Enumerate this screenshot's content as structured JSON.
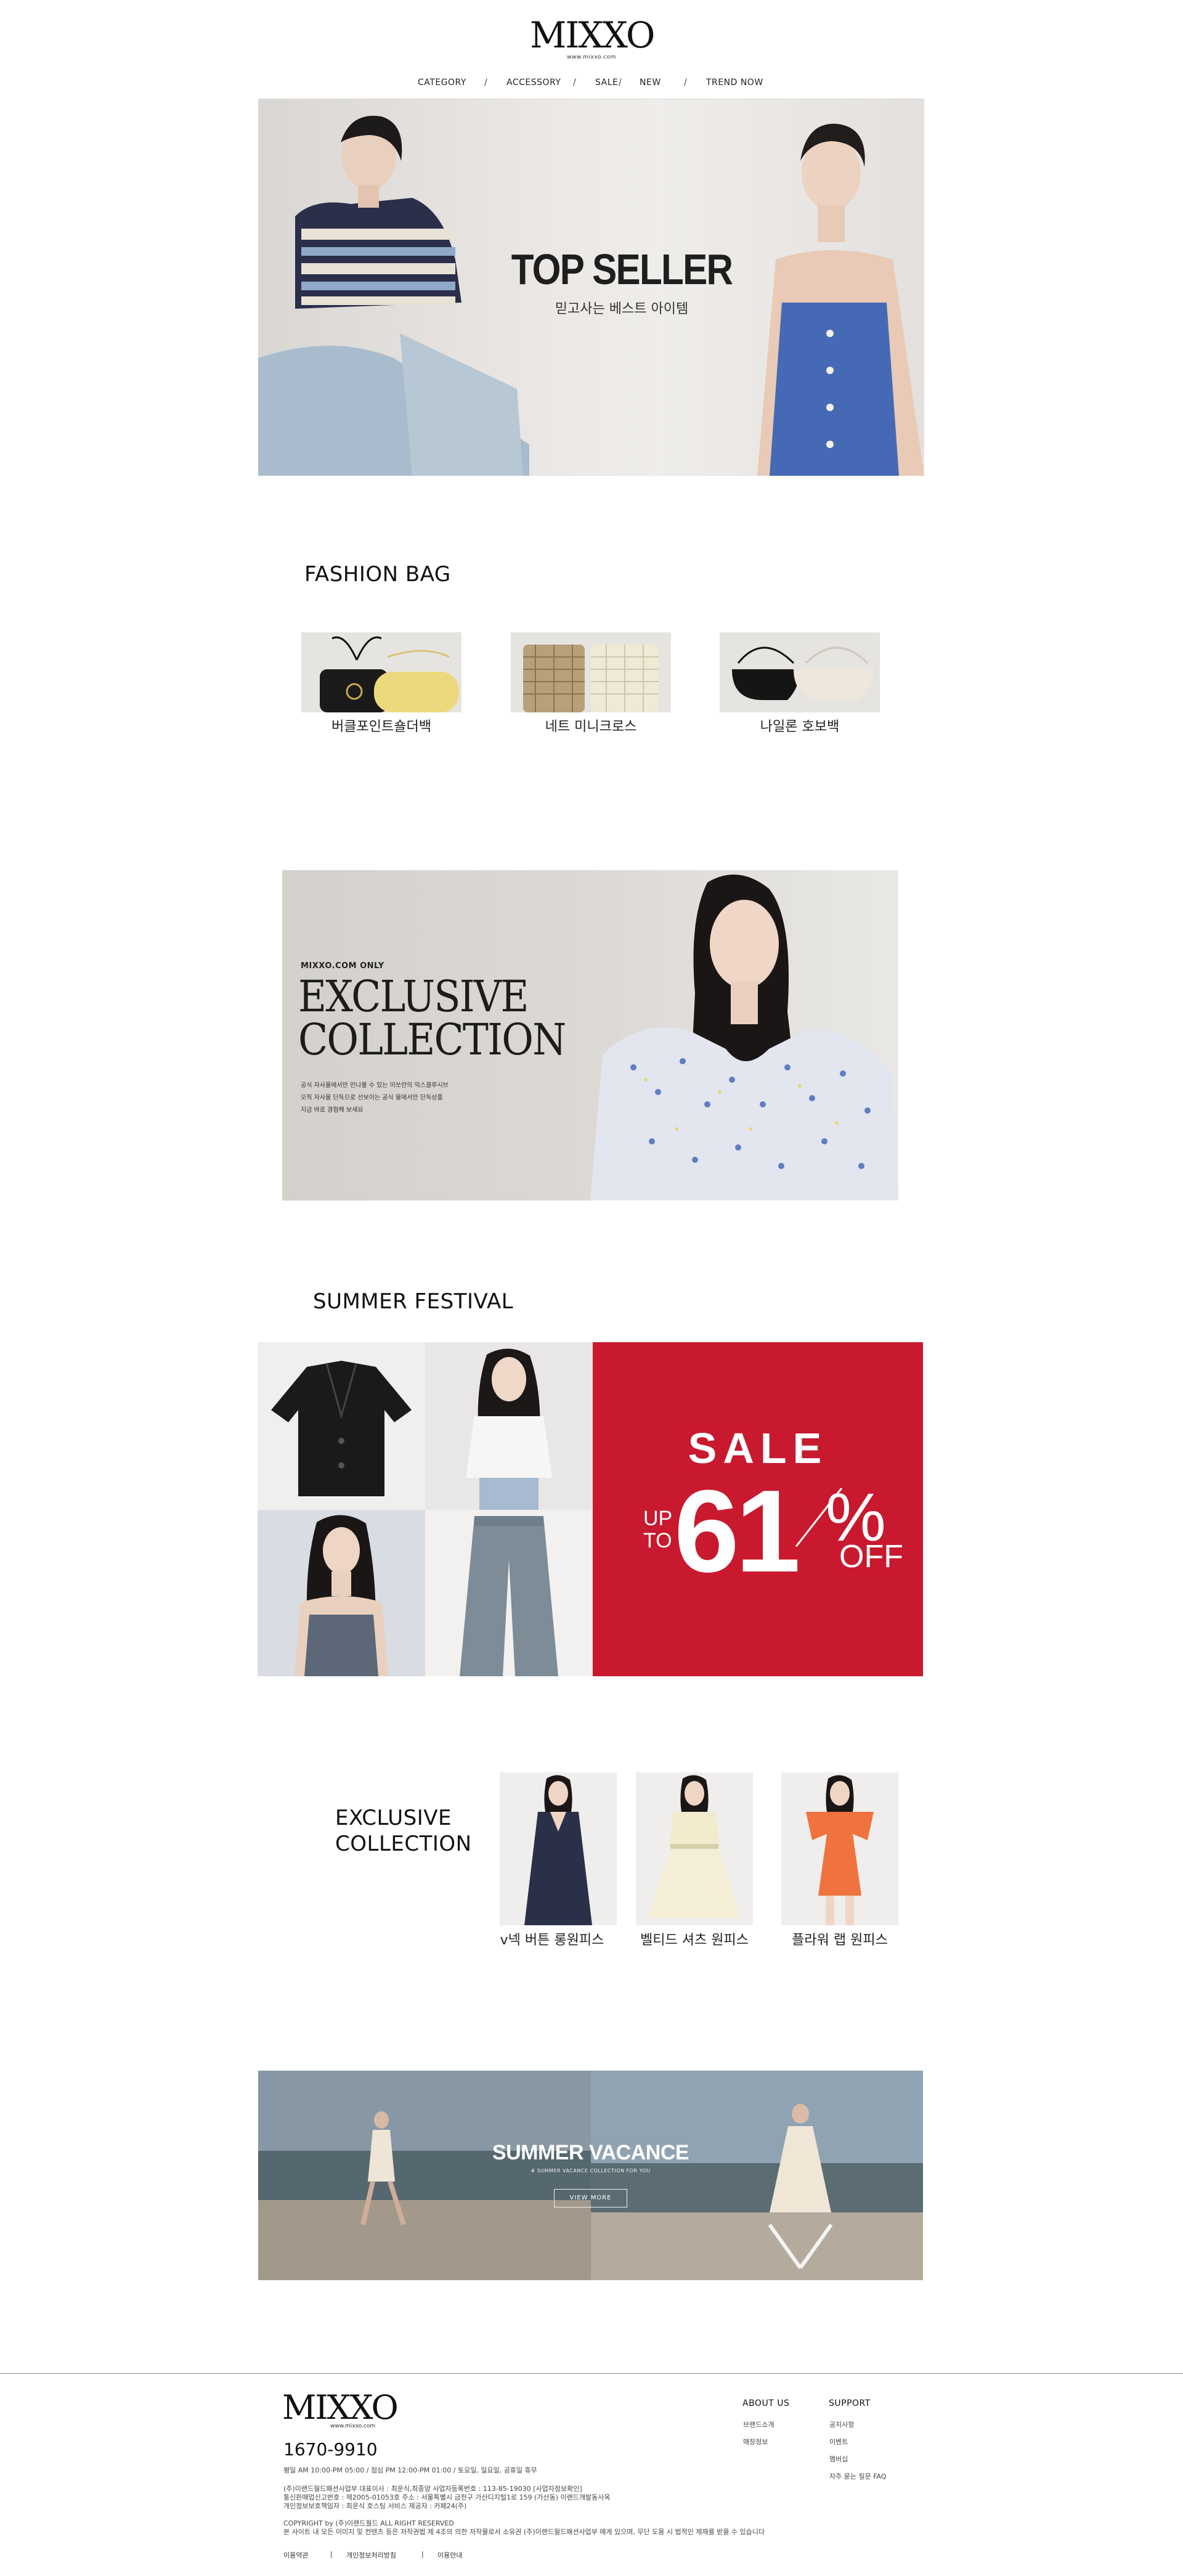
{
  "header": {
    "logo": "MIXXO",
    "logo_sub": "www.mixxo.com",
    "nav": [
      {
        "label": "CATEGORY"
      },
      {
        "label": "ACCESSORY"
      },
      {
        "label": "SALE"
      },
      {
        "label": "NEW"
      },
      {
        "label": "TREND NOW"
      }
    ],
    "separator": "/"
  },
  "hero": {
    "title": "TOP SELLER",
    "subtitle": "믿고사는 베스트 아이템"
  },
  "fashion_bag": {
    "title": "FASHION BAG",
    "items": [
      {
        "label": "버클포인트숄더백"
      },
      {
        "label": "네트 미니크로스"
      },
      {
        "label": "나일론 호보백"
      }
    ]
  },
  "exclusive_banner": {
    "tag": "MIXXO.COM ONLY",
    "line1": "EXCLUSIVE",
    "line2": "COLLECTION",
    "desc1": "공식 자사몰에서만 만나볼 수 있는 미쏘만의 익스클루시브",
    "desc2": "오직 자사몰 단독으로 선보이는 공식 몰에서만 단독상품",
    "desc3": "지금 바로 경험해 보세요"
  },
  "summer_festival": {
    "title": "SUMMER FESTIVAL",
    "sale_word": "SALE",
    "sale_up": "UP",
    "sale_to": "TO",
    "sale_number": "61",
    "sale_percent": "%",
    "sale_off": "OFF",
    "accent_color": "#c8192e"
  },
  "exclusive_collection": {
    "title_line1": "EXCLUSIVE",
    "title_line2": "COLLECTION",
    "items": [
      {
        "label": "v넥 버튼 롱원피스"
      },
      {
        "label": "벨티드 셔츠 원피스"
      },
      {
        "label": "플라워 랩 원피스"
      }
    ]
  },
  "vacance": {
    "title": "SUMMER VACANCE",
    "subtitle": "# SUMMER VACANCE COLLECTION FOR YOU",
    "button": "VIEW MORE"
  },
  "footer": {
    "logo": "MIXXO",
    "logo_sub": "www.mixxo.com",
    "phone": "1670-9910",
    "hours": "평일 AM 10:00-PM 05:00 / 점심 PM 12:00-PM 01:00 / 토요일, 일요일, 공휴일 휴무",
    "company1": "(주)이랜드월드패션사업부 대표이사 : 최운식,최종양 사업자등록번호 : 113-85-19030 [사업자정보확인]",
    "company2": "통신판매업신고번호 : 제2005-01053호 주소 : 서울특별시 금천구 가산디지털1로 159 (가산동) 이랜드개발동사옥",
    "company3": "개인정보보호책임자 : 최운식 호스팅 서비스 제공자 : 카페24(주)",
    "copyright": "COPYRIGHT by (주)이랜드월드 ALL RIGHT RESERVED",
    "notice": "본 사이트 내 모든 이미지 및 컨텐츠 등은 저작권법 제 4조의 의한 저작물로서 소유권 (주)이랜드월드패션사업부 에게 있으며, 무단 도용 시 법적인 제재를 받을 수 있습니다",
    "about_title": "ABOUT US",
    "about_links": [
      {
        "label": "브랜드소개"
      },
      {
        "label": "매장정보"
      }
    ],
    "support_title": "SUPPORT",
    "support_links": [
      {
        "label": "공지사항"
      },
      {
        "label": "이벤트"
      },
      {
        "label": "멤버십"
      },
      {
        "label": "자주 묻는 질문 FAQ"
      }
    ],
    "bottom_links": [
      {
        "label": "이용약관"
      },
      {
        "label": "개인정보처리방침"
      },
      {
        "label": "이용안내"
      }
    ],
    "bottom_sep": "|"
  }
}
